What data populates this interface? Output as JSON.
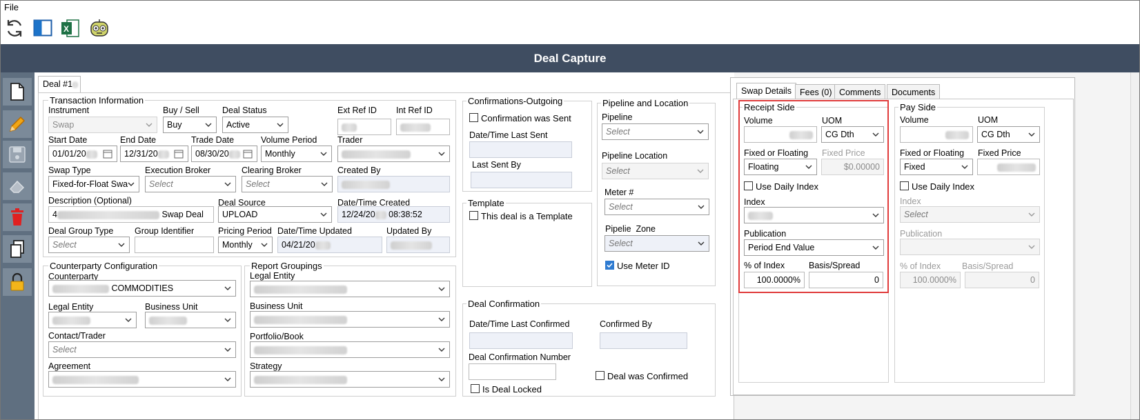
{
  "menu": {
    "file": "File"
  },
  "header": {
    "title": "Deal Capture"
  },
  "colors": {
    "header_bg": "#3f4d61",
    "sidebar_bg": "#5f6f80",
    "highlight": "#e03b3b",
    "check_on": "#2e7bd1"
  },
  "deal_tab": "Deal #1",
  "transaction": {
    "title": "Transaction Information",
    "instrument_label": "Instrument",
    "instrument_value": "Swap",
    "buy_sell_label": "Buy / Sell",
    "buy_sell_value": "Buy",
    "deal_status_label": "Deal Status",
    "deal_status_value": "Active",
    "ext_ref_label": "Ext Ref ID",
    "int_ref_label": "Int Ref ID",
    "start_date_label": "Start Date",
    "start_date_value": "01/01/20",
    "end_date_label": "End Date",
    "end_date_value": "12/31/20",
    "trade_date_label": "Trade Date",
    "trade_date_value": "08/30/20",
    "volume_period_label": "Volume Period",
    "volume_period_value": "Monthly",
    "trader_label": "Trader",
    "swap_type_label": "Swap Type",
    "swap_type_value": "Fixed-for-Float Swa",
    "exec_broker_label": "Execution Broker",
    "exec_broker_value": "Select",
    "clearing_broker_label": "Clearing Broker",
    "clearing_broker_value": "Select",
    "created_by_label": "Created By",
    "description_label": "Description (Optional)",
    "description_prefix": "4",
    "description_value": "Swap Deal",
    "deal_source_label": "Deal Source",
    "deal_source_value": "UPLOAD",
    "datetime_created_label": "Date/Time Created",
    "datetime_created_date": "12/24/20",
    "datetime_created_time": "08:38:52",
    "deal_group_type_label": "Deal Group Type",
    "deal_group_type_value": "Select",
    "group_identifier_label": "Group Identifier",
    "pricing_period_label": "Pricing Period",
    "pricing_period_value": "Monthly",
    "datetime_updated_label": "Date/Time Updated",
    "datetime_updated_value": "04/21/20",
    "updated_by_label": "Updated By"
  },
  "counterparty": {
    "title": "Counterparty Configuration",
    "counterparty_label": "Counterparty",
    "counterparty_value": "COMMODITIES",
    "legal_entity_label": "Legal Entity",
    "business_unit_label": "Business Unit",
    "contact_label": "Contact/Trader",
    "contact_value": "Select",
    "agreement_label": "Agreement"
  },
  "report_groupings": {
    "title": "Report Groupings",
    "legal_entity_label": "Legal Entity",
    "business_unit_label": "Business Unit",
    "portfolio_label": "Portfolio/Book",
    "strategy_label": "Strategy"
  },
  "confirmations": {
    "title": "Confirmations-Outgoing",
    "sent_label": "Confirmation was Sent",
    "last_sent_label": "Date/Time Last Sent",
    "last_sent_by_label": "Last Sent By"
  },
  "template": {
    "title": "Template",
    "is_template_label": "This deal is a Template"
  },
  "pipeline": {
    "title": "Pipeline and Location",
    "pipeline_label": "Pipeline",
    "pipeline_value": "Select",
    "location_label": "Pipeline Location",
    "location_value": "Select",
    "meter_label": "Meter #",
    "meter_value": "Select",
    "zone_label": "Pipelie  Zone",
    "zone_value": "Select",
    "use_meter_label": "Use Meter ID"
  },
  "deal_confirmation": {
    "title": "Deal Confirmation",
    "last_confirmed_label": "Date/Time Last Confirmed",
    "confirmed_by_label": "Confirmed By",
    "number_label": "Deal Confirmation Number",
    "was_confirmed_label": "Deal was Confirmed",
    "locked_label": "Is Deal Locked"
  },
  "right_tabs": [
    "Swap Details",
    "Fees (0)",
    "Comments",
    "Documents"
  ],
  "receipt": {
    "title": "Receipt Side",
    "volume_label": "Volume",
    "uom_label": "UOM",
    "uom_value": "CG Dth",
    "fixed_floating_label": "Fixed or Floating",
    "fixed_floating_value": "Floating",
    "fixed_price_label": "Fixed Price",
    "fixed_price_value": "$0.00000",
    "daily_index_label": "Use Daily Index",
    "index_label": "Index",
    "publication_label": "Publication",
    "publication_value": "Period End Value",
    "pct_index_label": "% of Index",
    "pct_index_value": "100.0000%",
    "basis_label": "Basis/Spread",
    "basis_value": "0"
  },
  "pay": {
    "title": "Pay Side",
    "volume_label": "Volume",
    "uom_label": "UOM",
    "uom_value": "CG Dth",
    "fixed_floating_label": "Fixed or Floating",
    "fixed_floating_value": "Fixed",
    "fixed_price_label": "Fixed Price",
    "daily_index_label": "Use Daily Index",
    "index_label": "Index",
    "index_value": "Select",
    "publication_label": "Publication",
    "pct_index_label": "% of Index",
    "pct_index_value": "100.0000%",
    "basis_label": "Basis/Spread",
    "basis_value": "0"
  }
}
